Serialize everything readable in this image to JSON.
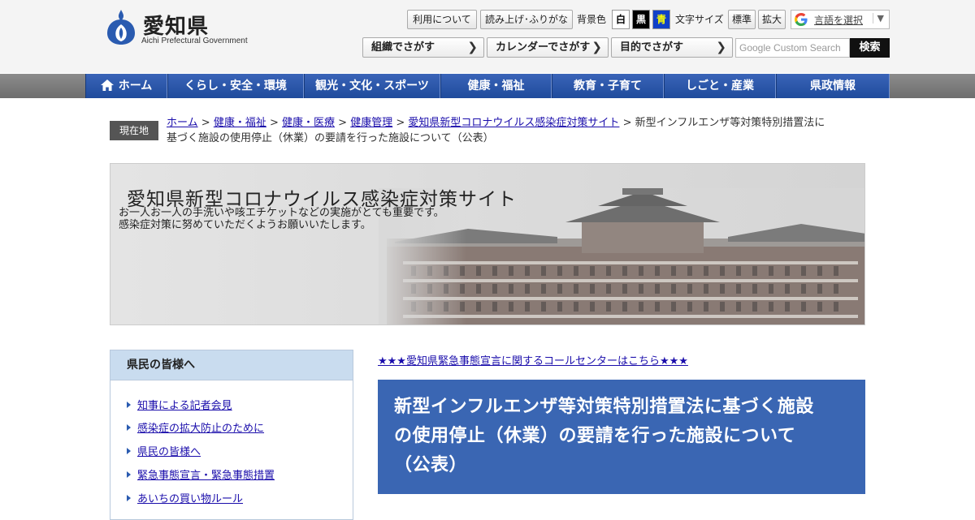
{
  "site": {
    "name": "愛知県",
    "name_en": "Aichi Prefectural Government"
  },
  "utility": {
    "usage_label": "利用について",
    "readaloud_label": "読み上げ･ふりがな",
    "bgcolor_label": "背景色",
    "bg_white": "白",
    "bg_black": "黒",
    "bg_blue": "青",
    "fontsize_label": "文字サイズ",
    "font_standard": "標準",
    "font_large": "拡大",
    "language_label": "言語を選択",
    "language_arrow": "▼"
  },
  "finders": {
    "org": "組織でさがす",
    "calendar": "カレンダーでさがす",
    "purpose": "目的でさがす",
    "chevron": "❯"
  },
  "search": {
    "placeholder": "Google Custom Search",
    "button": "検索"
  },
  "gnav": {
    "home": "ホーム",
    "items": [
      "くらし・安全・環境",
      "観光・文化・スポーツ",
      "健康・福祉",
      "教育・子育て",
      "しごと・産業",
      "県政情報"
    ]
  },
  "breadcrumb": {
    "label": "現在地",
    "sep": ">",
    "links": [
      "ホーム",
      "健康・福祉",
      "健康・医療",
      "健康管理",
      "愛知県新型コロナウイルス感染症対策サイト"
    ],
    "current_line1": "新型インフルエンザ等対策特別措置法に",
    "current_line2": "基づく施設の使用停止（休業）の要請を行った施設について（公表）"
  },
  "banner": {
    "title": "愛知県新型コロナウイルス感染症対策サイト",
    "line1": "お一人お一人の手洗いや咳エチケットなどの実施がとても重要です。",
    "line2": "感染症対策に努めていただくようお願いいたします。"
  },
  "sidebar": {
    "heading": "県民の皆様へ",
    "items": [
      "知事による記者会見",
      "感染症の拡大防止のために",
      "県民の皆様へ",
      "緊急事態宣言・緊急事態措置",
      "あいちの買い物ルール"
    ]
  },
  "main": {
    "notice": "★★★愛知県緊急事態宣言に関するコールセンターはこちら★★★",
    "title_line1": "新型インフルエンザ等対策特別措置法に基づく施設",
    "title_line2": "の使用停止（休業）の要請を行った施設について",
    "title_line3": "（公表）"
  },
  "colors": {
    "nav_blue": "#1f4b9c",
    "title_blue": "#3a66b3",
    "sidebar_head": "#c9dcef",
    "link": "#1a0dab"
  },
  "icons": {
    "logo": "aichi-emblem-icon",
    "home": "house-icon",
    "google": "google-g-icon"
  }
}
